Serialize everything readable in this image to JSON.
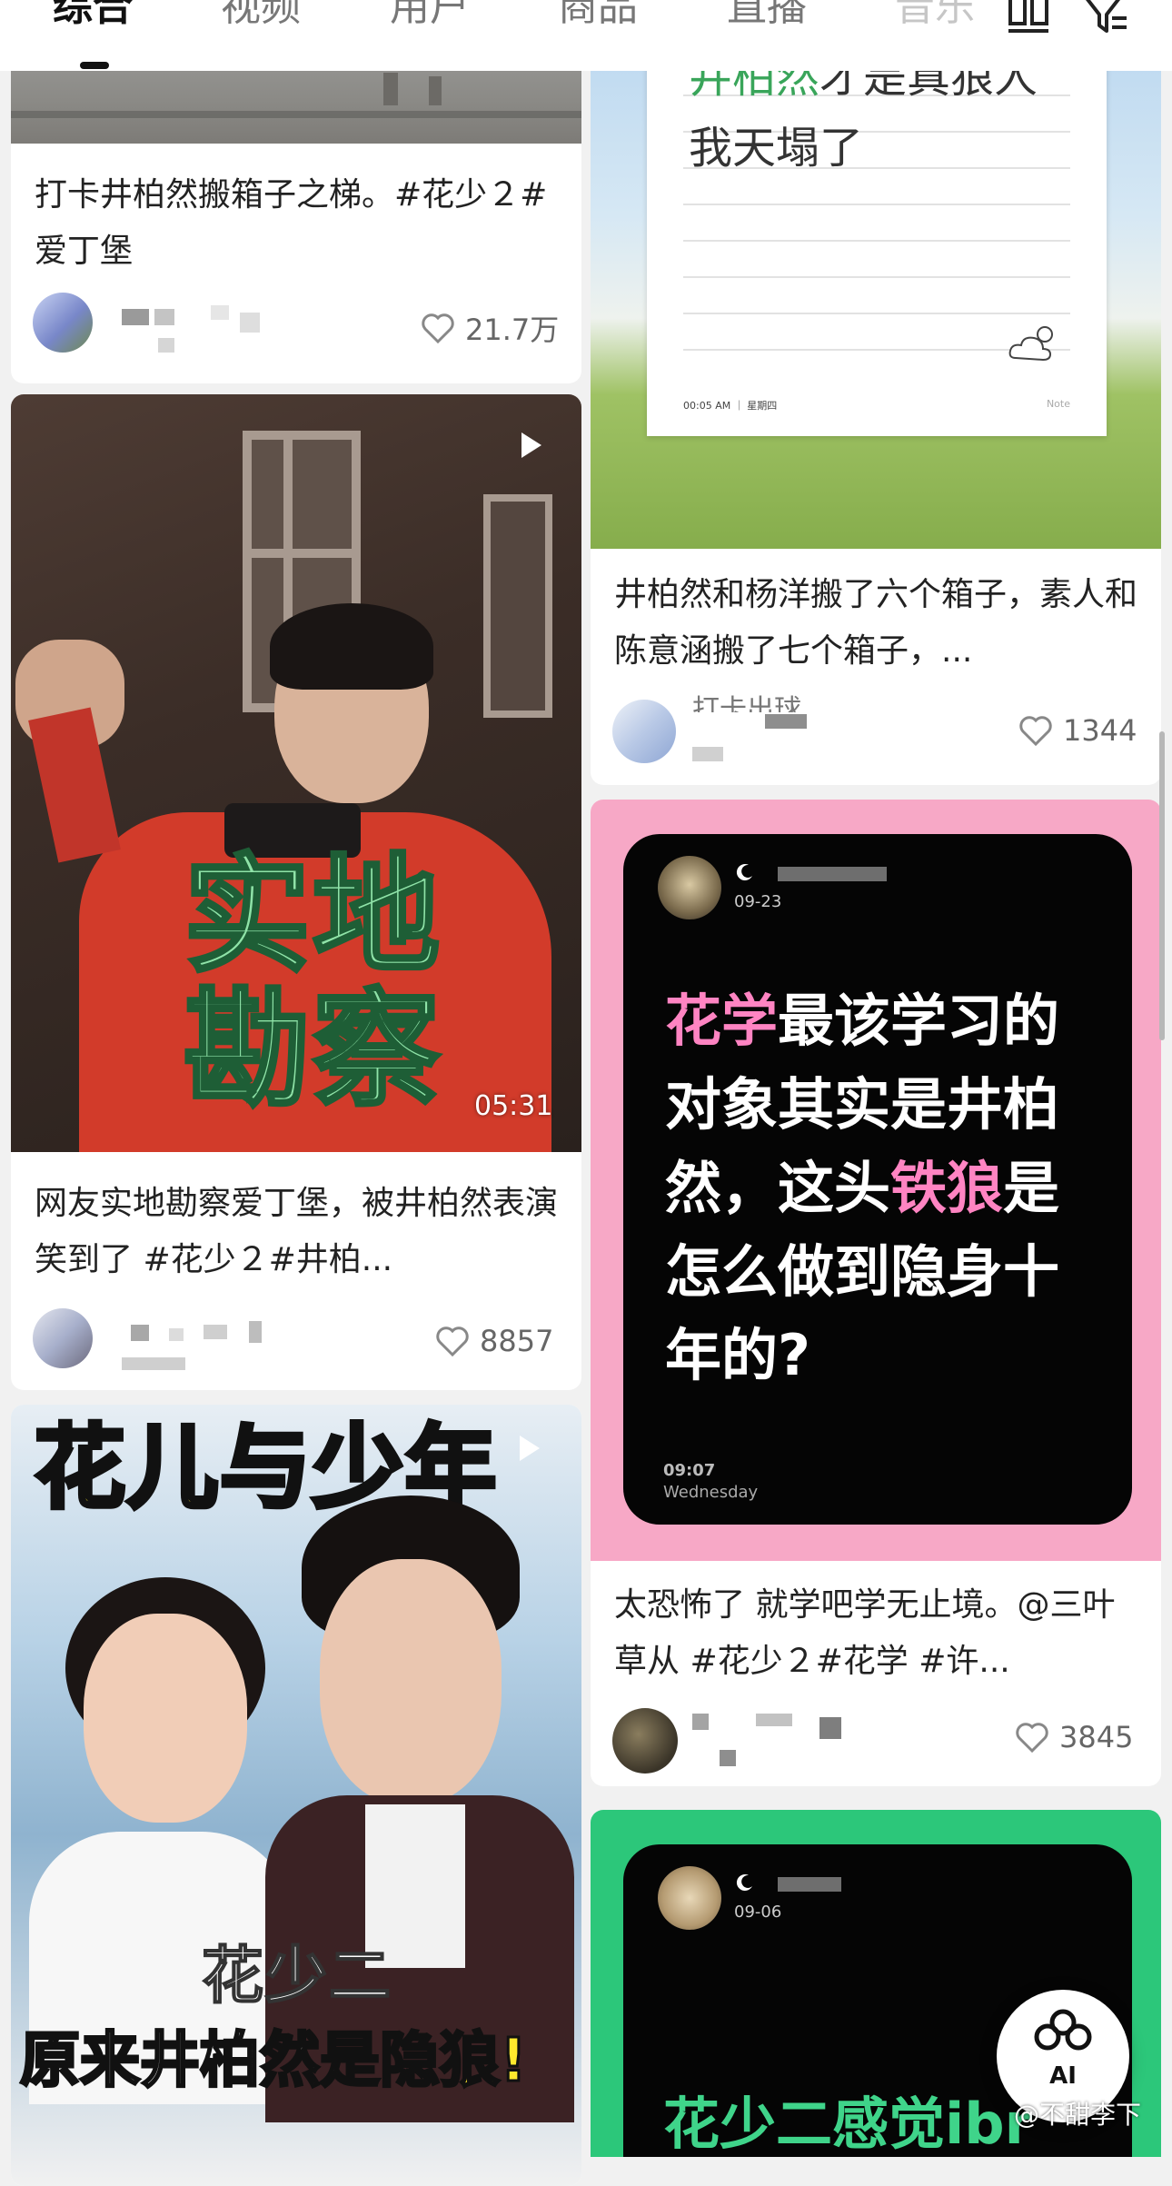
{
  "tabs": [
    {
      "label": "综合",
      "active": true
    },
    {
      "label": "视频"
    },
    {
      "label": "用户"
    },
    {
      "label": "商品"
    },
    {
      "label": "直播"
    },
    {
      "label": "音乐"
    }
  ],
  "toolbar": {
    "layout_icon": "grid-layout-icon",
    "filter_icon": "filter-icon"
  },
  "cards": {
    "left1": {
      "caption": "打卡井柏然搬箱子之梯。#花少２#爱丁堡",
      "likes": "21.7万"
    },
    "left2": {
      "overlay_line1": "实地",
      "overlay_line2": "勘察",
      "duration": "05:31",
      "caption": "网友实地勘察爱丁堡，被井柏然表演笑到了 #花少２#井柏...",
      "likes": "8857"
    },
    "left3": {
      "banner": "花儿与少年",
      "subtitle": "花少二",
      "headline_a": "原来井柏然是",
      "headline_b": "隐狼",
      "headline_c": "!"
    },
    "right1": {
      "note_line1_a": "井柏然",
      "note_line1_b": "才是真狼人",
      "note_line2": "我天塌了",
      "note_time": "00:05 AM ｜ 星期四",
      "note_label": "Note",
      "caption": "井柏然和杨洋搬了六个箱子，素人和陈意涵搬了七个箱子，...",
      "author_partial": "打卡出球",
      "likes": "1344"
    },
    "right2": {
      "post_date": "09-23",
      "text_a": "花学",
      "text_b": "最该学习的对象其实是井柏然，这头",
      "text_c": "铁狼",
      "text_d": "是怎么做到隐身十年的?",
      "time": "09:07",
      "weekday": "Wednesday",
      "caption": "太恐怖了 就学吧学无止境。@三叶草从 #花少２#花学 #许...",
      "likes": "3845"
    },
    "right3": {
      "post_date": "09-06",
      "text_partial": "花少二感觉ibr"
    }
  },
  "ai_button": {
    "label": "AI"
  },
  "watermark": "@不甜李下",
  "colors": {
    "pink_card": "#f7a8c6",
    "green_card": "#2cc77a",
    "accent_pink": "#ff84c2"
  }
}
